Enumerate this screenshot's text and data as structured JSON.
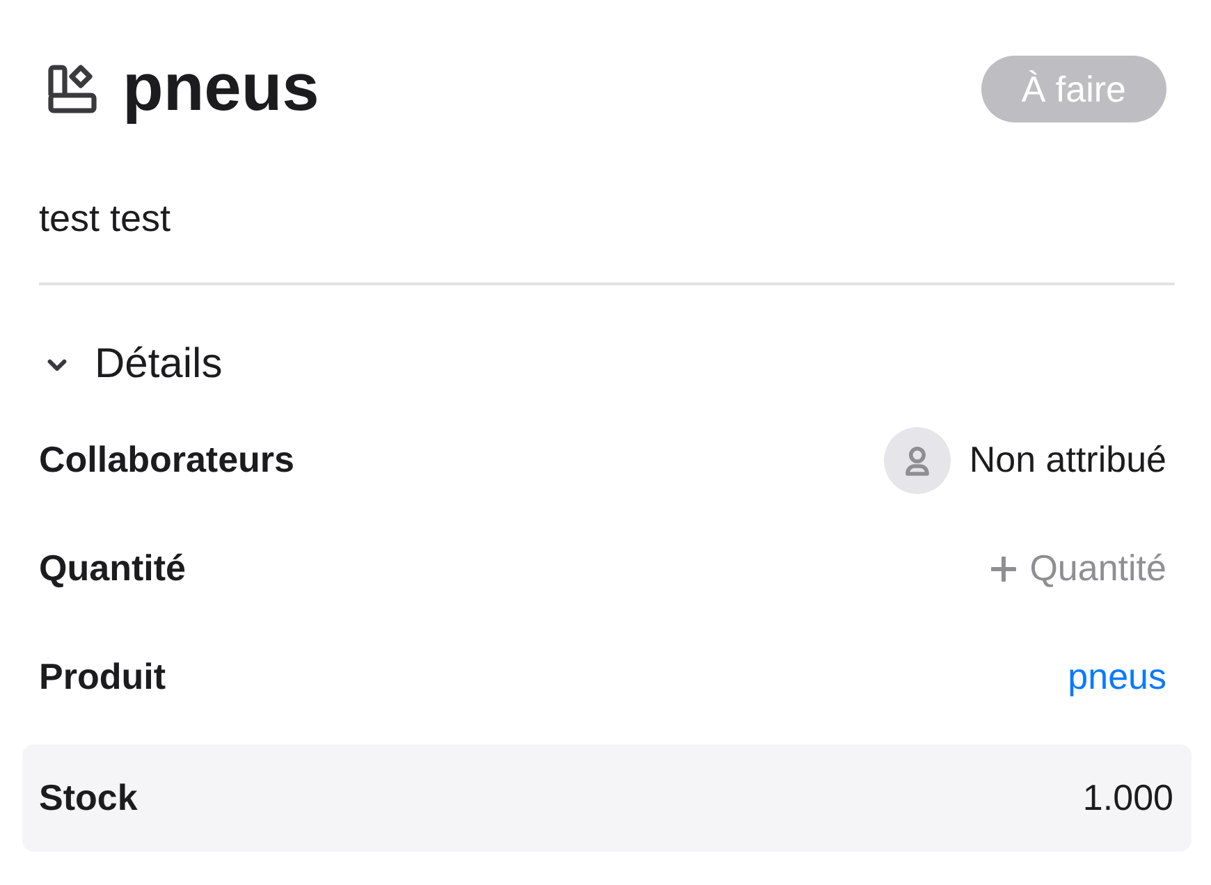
{
  "header": {
    "title": "pneus",
    "status": "À faire"
  },
  "description": "test test",
  "details": {
    "title": "Détails",
    "expanded": true,
    "fields": [
      {
        "kind": "assignee",
        "label": "Collaborateurs",
        "value": "Non attribué",
        "highlighted": false
      },
      {
        "kind": "add",
        "label": "Quantité",
        "action": "Quantité",
        "highlighted": false
      },
      {
        "kind": "link",
        "label": "Produit",
        "value": "pneus",
        "highlighted": false
      },
      {
        "kind": "text",
        "label": "Stock",
        "value": "1.000",
        "highlighted": true
      }
    ]
  }
}
